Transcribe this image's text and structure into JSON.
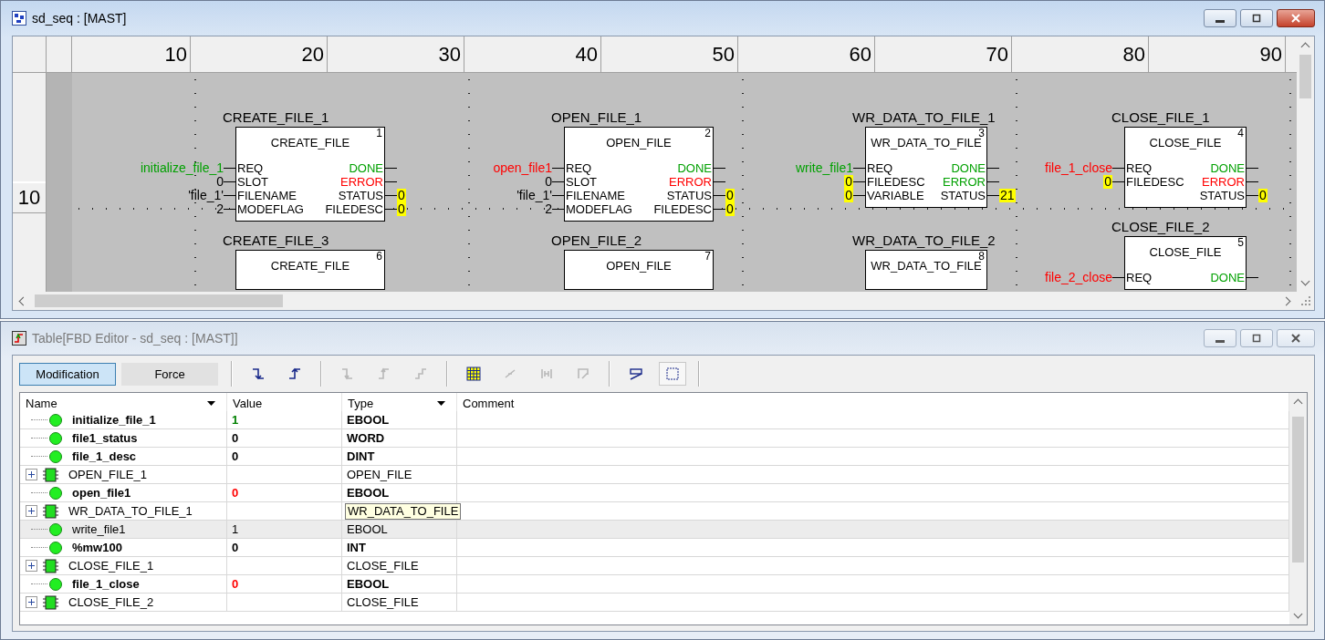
{
  "editor_window": {
    "title": "sd_seq : [MAST]",
    "active": true,
    "ruler": {
      "columns": [
        "10",
        "20",
        "30",
        "40",
        "50",
        "60",
        "70",
        "80",
        "90"
      ],
      "rows": [
        "10"
      ]
    },
    "block_columns": [
      [
        {
          "instance": "CREATE_FILE_1",
          "type": "CREATE_FILE",
          "number": "1",
          "inputs": [
            {
              "pin": "REQ",
              "kind": "variable",
              "value": "initialize_file_1",
              "color": "#00a000"
            },
            {
              "pin": "SLOT",
              "kind": "literal",
              "value": "0"
            },
            {
              "pin": "FILENAME",
              "kind": "literal",
              "value": "'file_1'"
            },
            {
              "pin": "MODEFLAG",
              "kind": "literal",
              "value": "2"
            }
          ],
          "outputs": [
            {
              "pin": "DONE",
              "color": "#00a000"
            },
            {
              "pin": "ERROR",
              "color": "#ff0000"
            },
            {
              "pin": "STATUS",
              "color": "#000000",
              "value": "0"
            },
            {
              "pin": "FILEDESC",
              "color": "#000000",
              "value": "0"
            }
          ]
        },
        {
          "instance": "CREATE_FILE_3",
          "type": "CREATE_FILE",
          "number": "6"
        }
      ],
      [
        {
          "instance": "OPEN_FILE_1",
          "type": "OPEN_FILE",
          "number": "2",
          "inputs": [
            {
              "pin": "REQ",
              "kind": "variable",
              "value": "open_file1",
              "color": "#ff0000"
            },
            {
              "pin": "SLOT",
              "kind": "literal",
              "value": "0"
            },
            {
              "pin": "FILENAME",
              "kind": "literal",
              "value": "'file_1'"
            },
            {
              "pin": "MODEFLAG",
              "kind": "literal",
              "value": "2"
            }
          ],
          "outputs": [
            {
              "pin": "DONE",
              "color": "#00a000"
            },
            {
              "pin": "ERROR",
              "color": "#ff0000"
            },
            {
              "pin": "STATUS",
              "color": "#000000",
              "value": "0"
            },
            {
              "pin": "FILEDESC",
              "color": "#000000",
              "value": "0"
            }
          ]
        },
        {
          "instance": "OPEN_FILE_2",
          "type": "OPEN_FILE",
          "number": "7"
        }
      ],
      [
        {
          "instance": "WR_DATA_TO_FILE_1",
          "type": "WR_DATA_TO_FILE",
          "number": "3",
          "inputs": [
            {
              "pin": "REQ",
              "kind": "variable",
              "value": "write_file1",
              "color": "#00a000"
            },
            {
              "pin": "FILEDESC",
              "kind": "live",
              "value": "0"
            },
            {
              "pin": "VARIABLE",
              "kind": "live",
              "value": "0"
            }
          ],
          "outputs": [
            {
              "pin": "DONE",
              "color": "#00a000"
            },
            {
              "pin": "ERROR",
              "color": "#00a000"
            },
            {
              "pin": "STATUS",
              "color": "#000000",
              "value": "21"
            }
          ]
        },
        {
          "instance": "WR_DATA_TO_FILE_2",
          "type": "WR_DATA_TO_FILE",
          "number": "8"
        }
      ],
      [
        {
          "instance": "CLOSE_FILE_1",
          "type": "CLOSE_FILE",
          "number": "4",
          "inputs": [
            {
              "pin": "REQ",
              "kind": "variable",
              "value": "file_1_close",
              "color": "#ff0000"
            },
            {
              "pin": "FILEDESC",
              "kind": "live",
              "value": "0"
            }
          ],
          "outputs": [
            {
              "pin": "DONE",
              "color": "#00a000"
            },
            {
              "pin": "ERROR",
              "color": "#ff0000"
            },
            {
              "pin": "STATUS",
              "color": "#000000",
              "value": "0"
            }
          ]
        },
        {
          "instance": "CLOSE_FILE_2",
          "type": "CLOSE_FILE",
          "number": "5",
          "inputs": [
            {
              "pin": "REQ",
              "kind": "variable",
              "value": "file_2_close",
              "color": "#ff0000"
            }
          ],
          "outputs": [
            {
              "pin": "DONE",
              "color": "#00a000"
            }
          ]
        }
      ]
    ]
  },
  "table_window": {
    "title": "Table[FBD Editor - sd_seq : [MAST]]",
    "active": false,
    "modes": [
      {
        "label": "Modification",
        "selected": true
      },
      {
        "label": "Force",
        "selected": false
      }
    ],
    "tools": [
      {
        "disabled": false
      },
      {
        "disabled": false
      },
      {
        "disabled": true
      },
      {
        "disabled": true
      },
      {
        "disabled": true
      },
      {
        "disabled": false
      },
      {
        "disabled": true
      },
      {
        "disabled": true
      },
      {
        "disabled": true
      },
      {
        "disabled": false
      },
      {
        "disabled": false
      }
    ],
    "table": {
      "columns": [
        {
          "label": "Name",
          "filter": true
        },
        {
          "label": "Value",
          "filter": false
        },
        {
          "label": "Type",
          "filter": true
        },
        {
          "label": "Comment",
          "filter": false
        }
      ],
      "rows": [
        {
          "kind": "variable",
          "name": "initialize_file_1",
          "value": "1",
          "color": "#008000",
          "type": "EBOOL",
          "selected": false,
          "tooltip": false
        },
        {
          "kind": "variable",
          "name": "file1_status",
          "value": "0",
          "type": "WORD",
          "selected": false,
          "tooltip": false
        },
        {
          "kind": "variable",
          "name": "file_1_desc",
          "value": "0",
          "type": "DINT",
          "selected": false,
          "tooltip": false
        },
        {
          "kind": "instance",
          "name": "OPEN_FILE_1",
          "expanded": false,
          "type": "OPEN_FILE",
          "selected": false,
          "tooltip": false
        },
        {
          "kind": "variable",
          "name": "open_file1",
          "value": "0",
          "color": "#ff0000",
          "type": "EBOOL",
          "selected": false,
          "tooltip": false
        },
        {
          "kind": "instance",
          "name": "WR_DATA_TO_FILE_1",
          "expanded": false,
          "type": "WR_DATA_TO_FILE",
          "selected": false,
          "tooltip": true
        },
        {
          "kind": "variable",
          "name": "write_file1",
          "value": "1",
          "type": "EBOOL",
          "selected": true,
          "tooltip": false
        },
        {
          "kind": "variable",
          "name": "%mw100",
          "value": "0",
          "type": "INT",
          "selected": false,
          "tooltip": false
        },
        {
          "kind": "instance",
          "name": "CLOSE_FILE_1",
          "expanded": false,
          "type": "CLOSE_FILE",
          "selected": false,
          "tooltip": false
        },
        {
          "kind": "variable",
          "name": "file_1_close",
          "value": "0",
          "color": "#ff0000",
          "type": "EBOOL",
          "selected": false,
          "tooltip": false
        },
        {
          "kind": "instance",
          "name": "CLOSE_FILE_2",
          "expanded": false,
          "type": "CLOSE_FILE",
          "selected": false,
          "tooltip": false
        }
      ]
    }
  }
}
